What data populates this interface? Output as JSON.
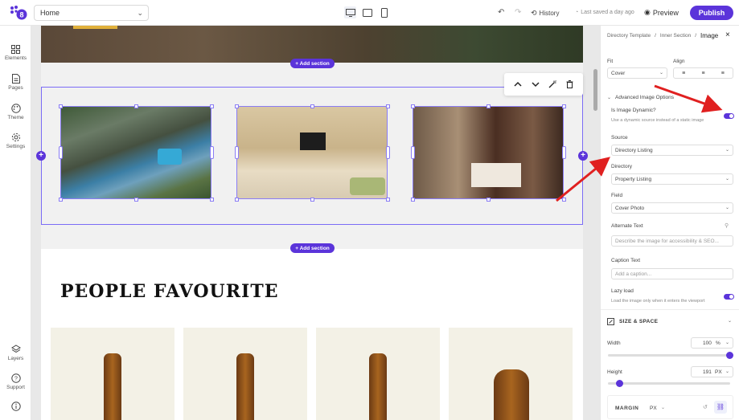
{
  "topbar": {
    "page_select": "Home",
    "history_label": "History",
    "saved_text": "Last saved a day ago",
    "preview_label": "Preview",
    "publish_label": "Publish"
  },
  "sidebar": {
    "items": [
      {
        "label": "Elements",
        "icon": "grid-icon"
      },
      {
        "label": "Pages",
        "icon": "page-icon"
      },
      {
        "label": "Theme",
        "icon": "palette-icon"
      },
      {
        "label": "Settings",
        "icon": "gear-icon"
      }
    ],
    "bottom_items": [
      {
        "label": "Layers",
        "icon": "layers-icon"
      },
      {
        "label": "Support",
        "icon": "help-icon"
      },
      {
        "label": "",
        "icon": "info-icon"
      }
    ]
  },
  "canvas": {
    "add_section_label": "+ Add section",
    "heading": "PEOPLE FAVOURITE"
  },
  "panel": {
    "breadcrumb": [
      "Directory Template",
      "Inner Section",
      "Image"
    ],
    "fit_label": "Fit",
    "fit_value": "Cover",
    "align_label": "Align",
    "advanced_label": "Advanced Image Options",
    "dynamic_label": "Is Image Dynamic?",
    "dynamic_sub": "Use a dynamic source instead of a static image",
    "source_label": "Source",
    "source_value": "Directory Listing",
    "directory_label": "Directory",
    "directory_value": "Property Listing",
    "field_label": "Field",
    "field_value": "Cover Photo",
    "alt_label": "Alternate Text",
    "alt_placeholder": "Describe the image for accessibility & SEO...",
    "caption_label": "Caption Text",
    "caption_placeholder": "Add a caption...",
    "lazy_label": "Lazy load",
    "lazy_sub": "Load the image only when it enters the viewport",
    "size_label": "SIZE & SPACE",
    "width_label": "Width",
    "width_value": "100",
    "width_unit": "%",
    "height_label": "Height",
    "height_value": "191",
    "height_unit": "PX",
    "margin_label": "MARGIN",
    "margin_unit": "PX"
  },
  "colors": {
    "accent": "#5b34da",
    "arrow": "#e02020"
  }
}
